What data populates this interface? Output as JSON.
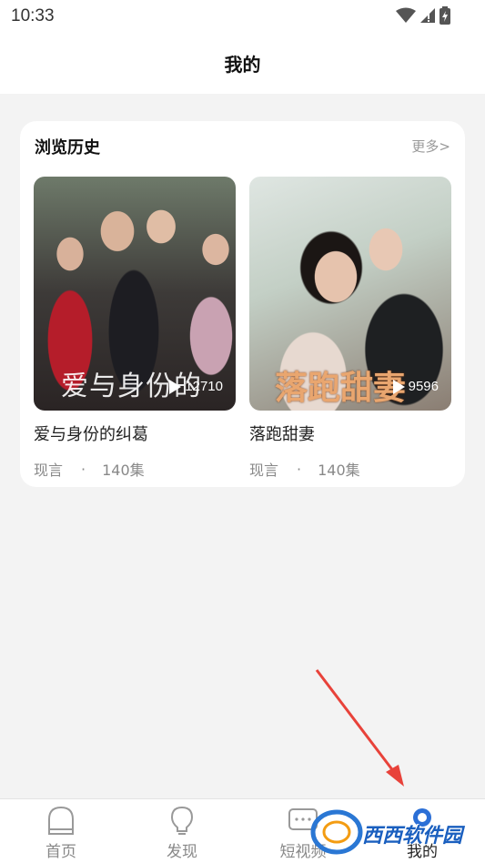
{
  "status_bar": {
    "time": "10:33",
    "icons": [
      "wifi-icon",
      "signal-icon",
      "battery-icon"
    ]
  },
  "header": {
    "title": "我的"
  },
  "history": {
    "title": "浏览历史",
    "more_label": "更多>",
    "items": [
      {
        "name": "爱与身份的纠葛",
        "poster_title": "爱与身份的",
        "play_count": "12710",
        "genre": "现言",
        "separator": "·",
        "episodes": "140集"
      },
      {
        "name": "落跑甜妻",
        "poster_title": "落跑甜妻",
        "play_count": "9596",
        "genre": "现言",
        "separator": "·",
        "episodes": "140集"
      }
    ]
  },
  "bottom_nav": {
    "items": [
      {
        "label": "首页",
        "icon": "home-icon"
      },
      {
        "label": "发现",
        "icon": "lightbulb-icon"
      },
      {
        "label": "短视频",
        "icon": "video-icon"
      },
      {
        "label": "我的",
        "icon": "profile-icon"
      }
    ]
  },
  "watermark": {
    "text": "西西软件园"
  },
  "colors": {
    "page_background": "#f3f3f3",
    "card_background": "#ffffff",
    "annotation_arrow": "#e8423a",
    "muted_text": "#888888"
  }
}
